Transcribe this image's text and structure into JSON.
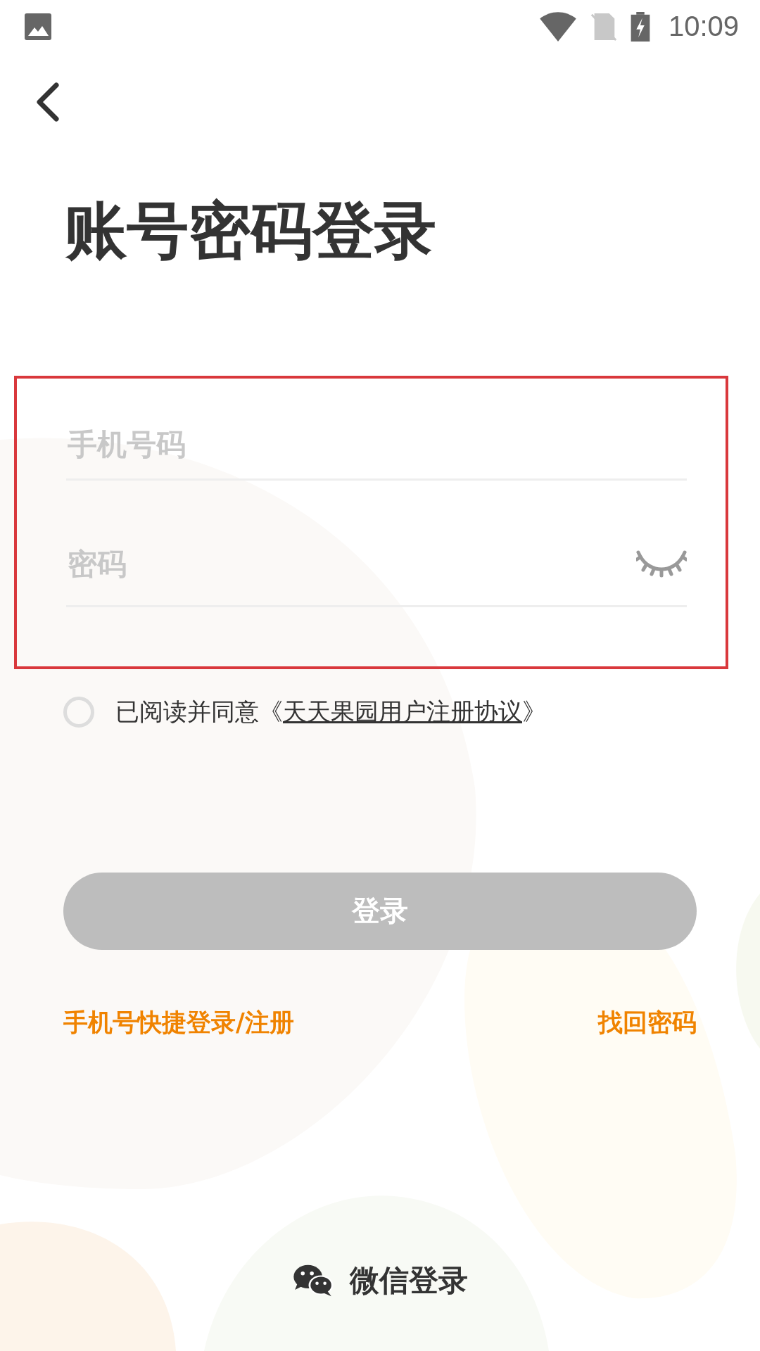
{
  "status_bar": {
    "time": "10:09"
  },
  "title": "账号密码登录",
  "highlight_frame": true,
  "fields": [
    {
      "kind": "phone",
      "placeholder": "手机号码"
    },
    {
      "kind": "password",
      "placeholder": "密码",
      "reveal": false
    }
  ],
  "agreement": {
    "checked": false,
    "prefix": "已阅读并同意《",
    "link": "天天果园用户注册协议",
    "suffix": "》"
  },
  "login_button": {
    "label": "登录",
    "disabled": true
  },
  "links": [
    {
      "label": "手机号快捷登录/注册"
    },
    {
      "label": "找回密码"
    }
  ],
  "wechat_login": {
    "label": "微信登录"
  }
}
